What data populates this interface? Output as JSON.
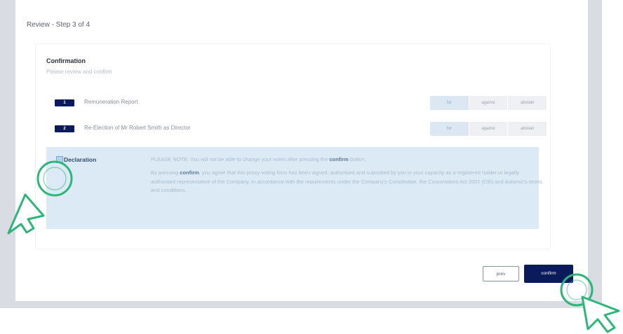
{
  "header": {
    "step_title": "Review - Step 3 of 4"
  },
  "confirmation": {
    "title": "Confirmation",
    "subtitle": "Please review and confirm"
  },
  "resolutions": [
    {
      "number": "1",
      "title": "Remuneration Report",
      "votes": [
        "for",
        "against",
        "abstain"
      ],
      "selected": "for"
    },
    {
      "number": "2",
      "title": "Re-Election of Mr Robert Smith as Director",
      "votes": [
        "for",
        "against",
        "abstain"
      ],
      "selected": "for"
    }
  ],
  "declaration": {
    "label": "Declaration",
    "note_prefix": "PLEASE NOTE: You will not be able to change your votes after pressing the ",
    "note_bold": "confirm",
    "note_suffix": " button.",
    "body_prefix": "By pressing ",
    "body_bold": "confirm",
    "body_suffix": ", you agree that this proxy voting form has been signed, authorised and submitted by you in your capacity as a registered holder or legally authorised representative of the Company, in accordance with the requirements under the Company's Constitution, the Corporations Act 2001 (Cth) and Automic's terms and conditions."
  },
  "actions": {
    "prev_label": "prev",
    "confirm_label": "confirm"
  },
  "colors": {
    "brand_navy": "#0b1a5a",
    "declaration_bg": "#dceaf5",
    "annotation_green": "#2fb57a"
  },
  "icons": {
    "pointer_annotation_left": "hand-pointer-icon",
    "pointer_annotation_right": "hand-pointer-icon"
  }
}
